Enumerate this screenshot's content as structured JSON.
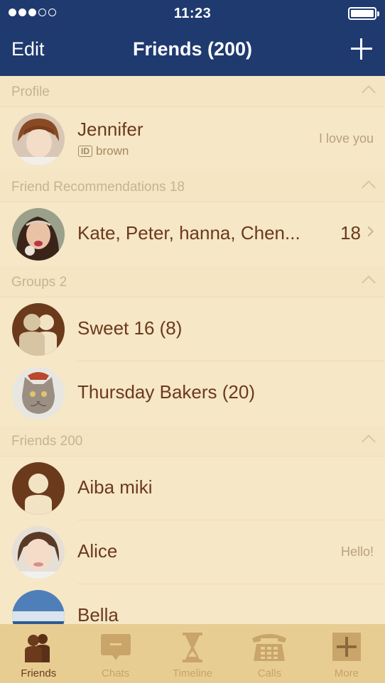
{
  "status_bar": {
    "time": "11:23"
  },
  "nav": {
    "edit_label": "Edit",
    "title": "Friends (200)"
  },
  "sections": {
    "profile": {
      "label": "Profile"
    },
    "recommendations": {
      "label": "Friend Recommendations 18"
    },
    "groups": {
      "label": "Groups 2"
    },
    "friends": {
      "label": "Friends 200"
    }
  },
  "profile": {
    "name": "Jennifer",
    "id_badge": "ID",
    "id": "brown",
    "status": "I love you"
  },
  "recommendation": {
    "names": "Kate, Peter, hanna, Chen...",
    "count": "18"
  },
  "groups": [
    {
      "name": "Sweet 16 (8)"
    },
    {
      "name": "Thursday Bakers (20)"
    }
  ],
  "friends": [
    {
      "name": "Aiba miki",
      "status": ""
    },
    {
      "name": "Alice",
      "status": "Hello!"
    },
    {
      "name": "Bella",
      "status": ""
    }
  ],
  "tabs": [
    {
      "label": "Friends",
      "icon": "friends-icon",
      "active": true
    },
    {
      "label": "Chats",
      "icon": "chat-bubble-icon",
      "active": false
    },
    {
      "label": "Timeline",
      "icon": "hourglass-icon",
      "active": false
    },
    {
      "label": "Calls",
      "icon": "phone-icon",
      "active": false
    },
    {
      "label": "More",
      "icon": "plus-box-icon",
      "active": false
    }
  ],
  "colors": {
    "nav_bg": "#1f3a6e",
    "list_bg": "#f6e7c6",
    "tab_bg": "#e8cd93",
    "text_brown": "#6b3a1c"
  }
}
